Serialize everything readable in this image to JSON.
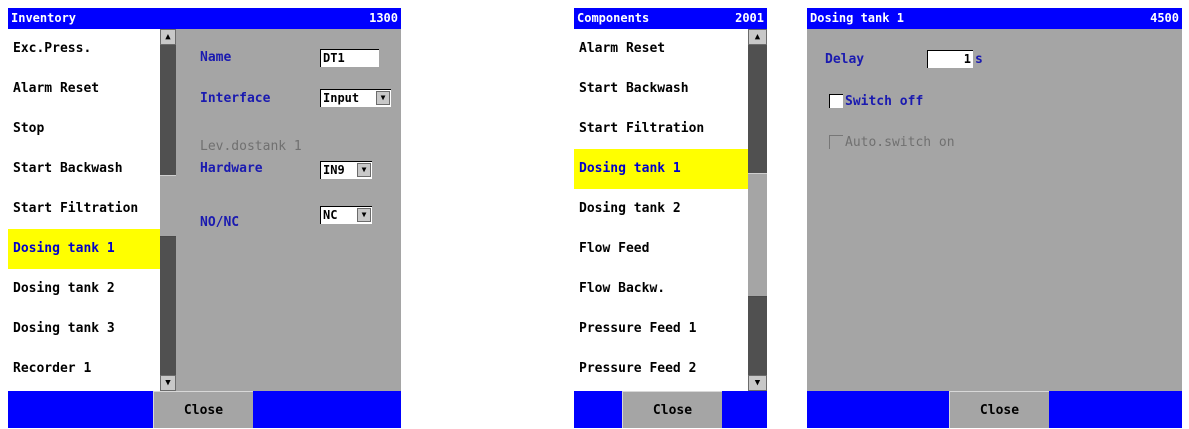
{
  "inventory": {
    "title": "Inventory",
    "code": "1300",
    "items": [
      "Exc.Press.",
      "Alarm Reset",
      "Stop",
      "Start Backwash",
      "Start Filtration",
      "Dosing tank 1",
      "Dosing tank 2",
      "Dosing tank 3",
      "Recorder 1"
    ],
    "selected_index": 5,
    "name_label": "Name",
    "name_value": "DT1",
    "interface_label": "Interface",
    "interface_value": "Input",
    "lev_label": "Lev.dostank 1",
    "hardware_label": "Hardware",
    "hardware_value": "IN9",
    "nonc_label": "NO/NC",
    "nonc_value": "NC",
    "close_label": "Close"
  },
  "components": {
    "title": "Components",
    "code": "2001",
    "items": [
      "Alarm Reset",
      "Start Backwash",
      "Start Filtration",
      "Dosing tank 1",
      "Dosing tank 2",
      "Flow Feed",
      "Flow Backw.",
      "Pressure Feed 1",
      "Pressure Feed 2"
    ],
    "selected_index": 3,
    "close_label": "Close"
  },
  "dosing": {
    "title": "Dosing tank 1",
    "code": "4500",
    "delay_label": "Delay",
    "delay_value": "1",
    "delay_unit": "s",
    "switch_off_label": "Switch off",
    "switch_off_checked": false,
    "auto_switch_label": "Auto.switch on",
    "auto_switch_checked": false,
    "close_label": "Close"
  },
  "colors": {
    "titlebar": "#0000ff",
    "panel": "#a5a5a5",
    "selection": "#ffff00",
    "label": "#1a1ab0"
  },
  "icons": {
    "up": "scroll-up-arrow-icon",
    "down": "scroll-down-arrow-icon",
    "dropdown": "dropdown-arrow-icon"
  }
}
